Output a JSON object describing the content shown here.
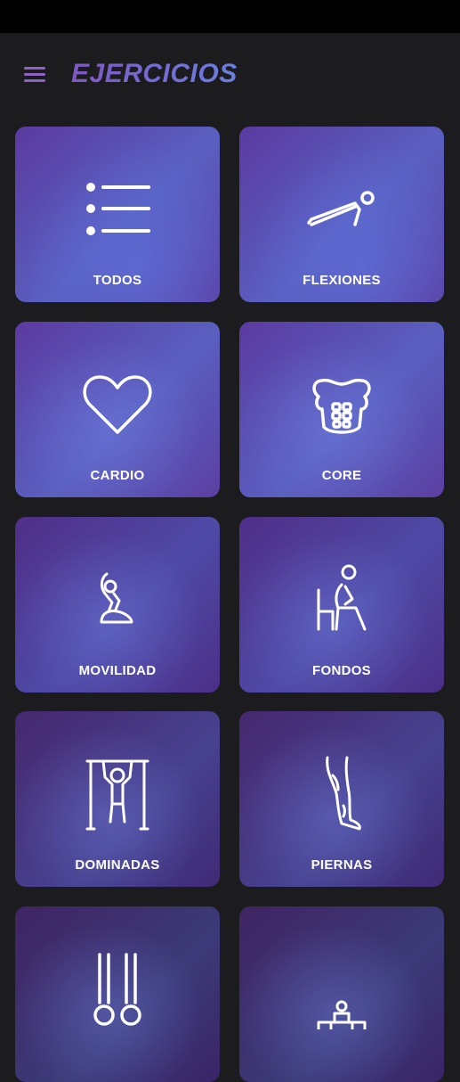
{
  "header": {
    "title": "EJERCICIOS",
    "menu_icon": "hamburger-menu-icon",
    "accent": "#8a62c8"
  },
  "categories": [
    {
      "label": "TODOS",
      "icon": "list-icon"
    },
    {
      "label": "FLEXIONES",
      "icon": "pushup-icon"
    },
    {
      "label": "CARDIO",
      "icon": "heart-icon"
    },
    {
      "label": "CORE",
      "icon": "abs-icon"
    },
    {
      "label": "MOVILIDAD",
      "icon": "stretch-icon"
    },
    {
      "label": "FONDOS",
      "icon": "dips-icon"
    },
    {
      "label": "DOMINADAS",
      "icon": "pullup-icon"
    },
    {
      "label": "PIERNAS",
      "icon": "leg-icon"
    },
    {
      "label": "",
      "icon": "rings-icon"
    },
    {
      "label": "",
      "icon": "bench-icon"
    }
  ]
}
